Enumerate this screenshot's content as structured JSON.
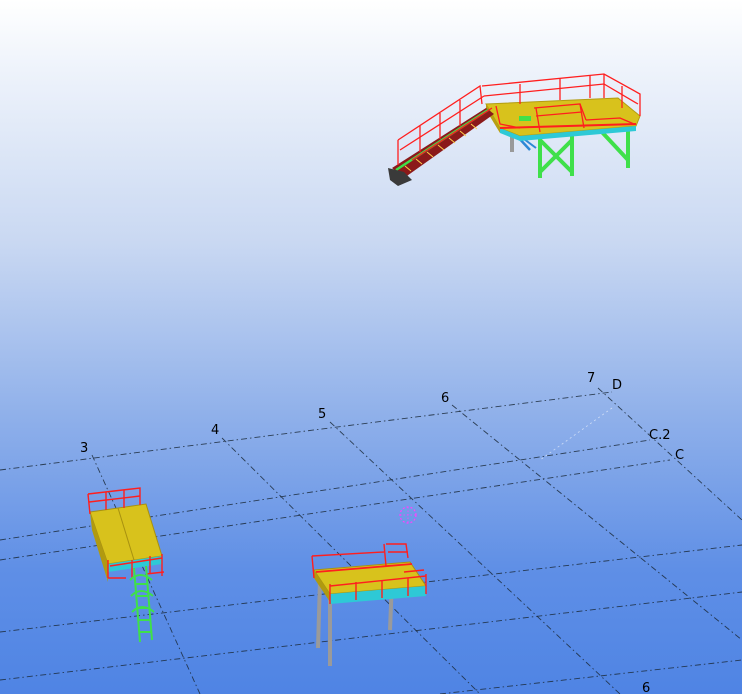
{
  "grid": {
    "labels": [
      "3",
      "4",
      "5",
      "6",
      "7",
      "D",
      "C.2",
      "C",
      "6"
    ]
  },
  "colors": {
    "background_top": "#ffffff",
    "background_bottom": "#4f84e4",
    "handrail": "#ff1e1e",
    "deck": "#d8c21c",
    "steel_green": "#3fe04a",
    "beam_cyan": "#2ec9d6",
    "column_grey": "#9a9a9a",
    "pick_marker": "#ff40ff"
  },
  "objects": {
    "stair_platform": "stair-and-platform-assembly",
    "ladder_platform": "ladder-platform-assembly",
    "column_platform": "column-platform-assembly",
    "marker": "selection-circle-marker"
  }
}
